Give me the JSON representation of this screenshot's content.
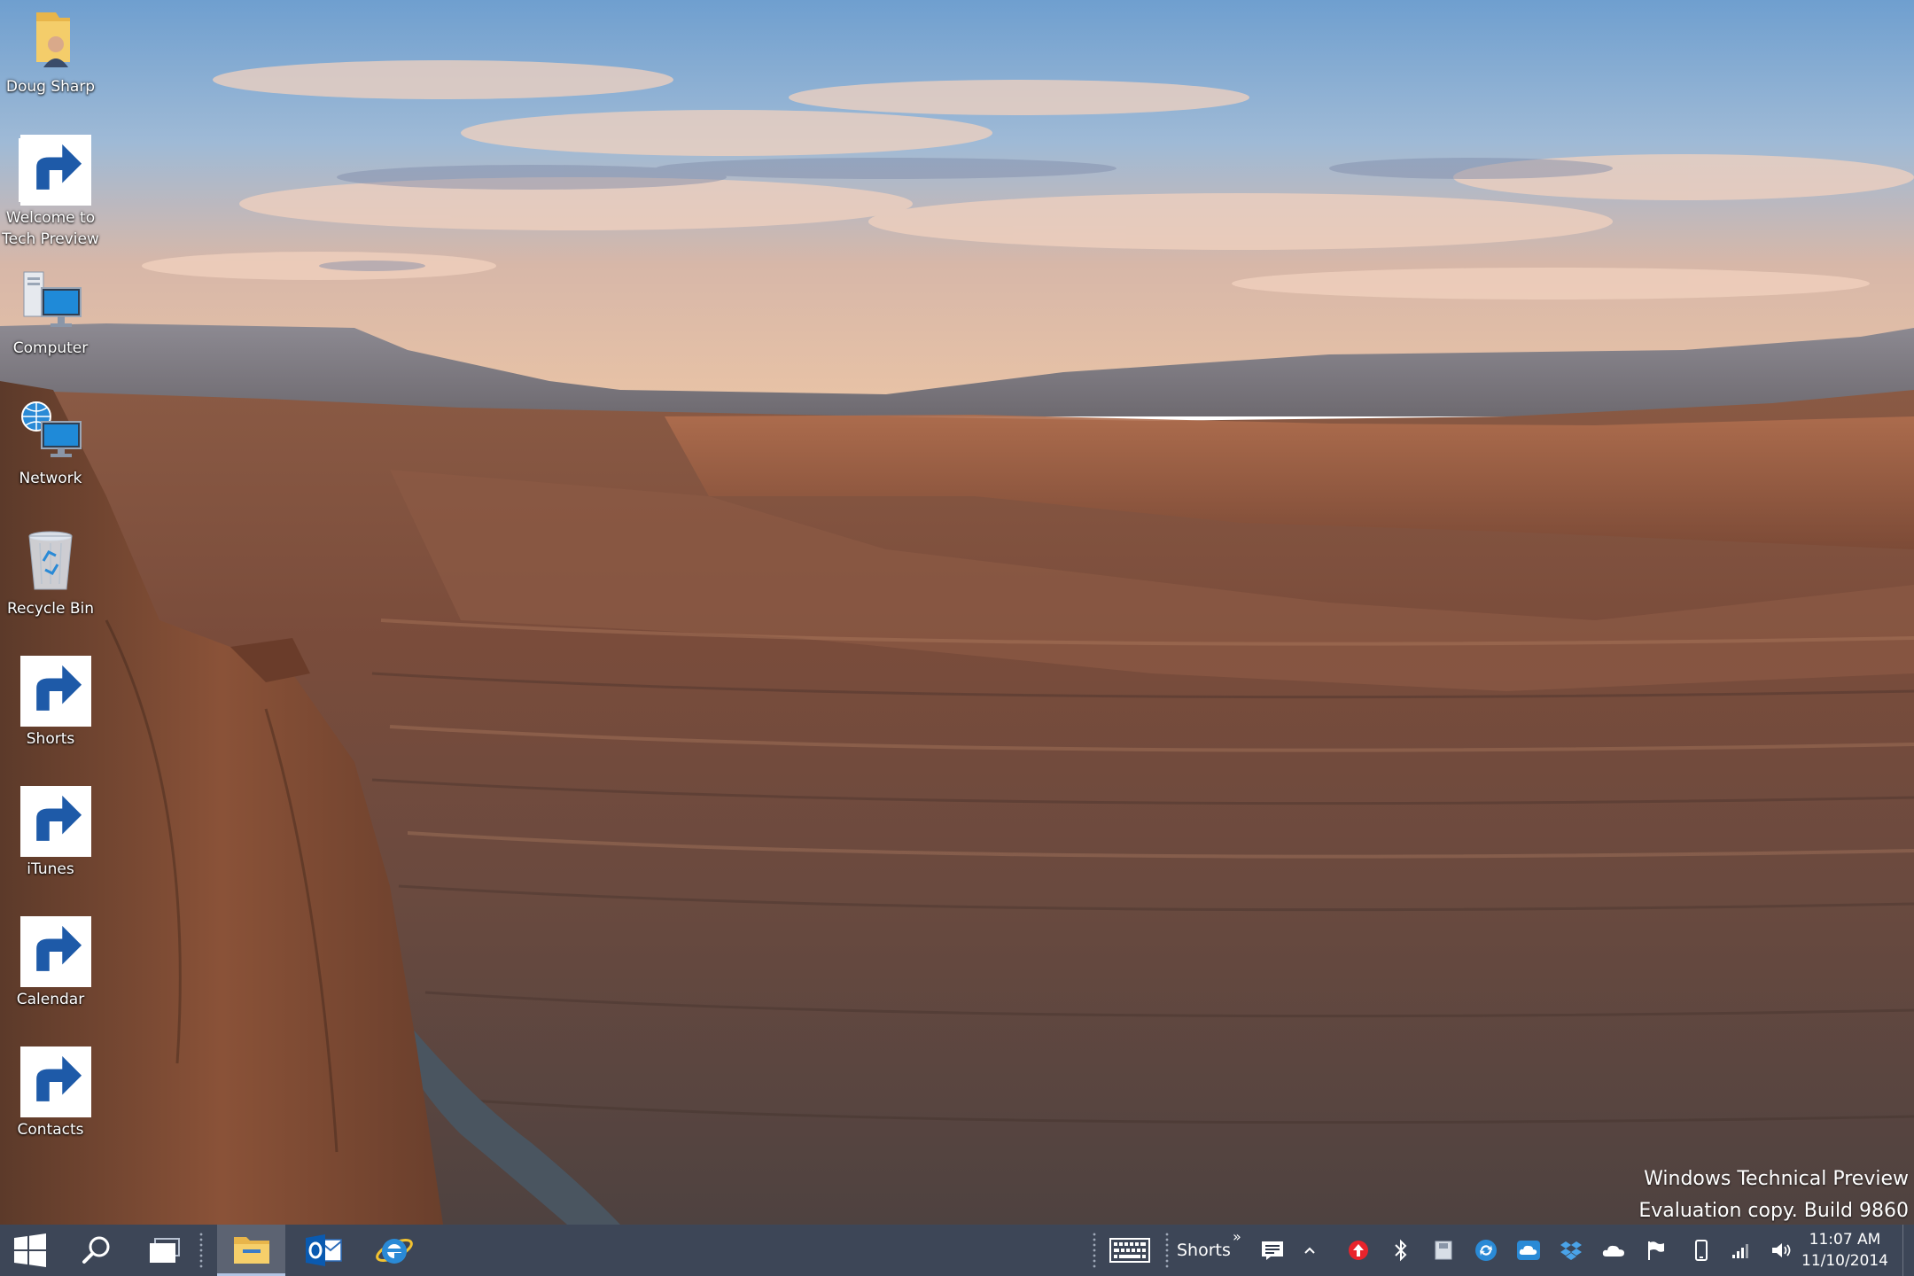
{
  "desktop": {
    "icons": [
      {
        "label": "Doug Sharp",
        "icon": "user-folder-icon",
        "shortcut": false
      },
      {
        "label": "Welcome to Tech Preview",
        "icon": "windows-logo-icon",
        "shortcut": true
      },
      {
        "label": "Computer",
        "icon": "computer-icon",
        "shortcut": false
      },
      {
        "label": "Network",
        "icon": "network-icon",
        "shortcut": false
      },
      {
        "label": "Recycle Bin",
        "icon": "recycle-bin-icon",
        "shortcut": false
      },
      {
        "label": "Shorts",
        "icon": "folder-icon",
        "shortcut": true
      },
      {
        "label": "iTunes",
        "icon": "itunes-icon",
        "shortcut": true
      },
      {
        "label": "Calendar",
        "icon": "calendar-icon",
        "shortcut": true
      },
      {
        "label": "Contacts",
        "icon": "contacts-icon",
        "shortcut": true
      }
    ],
    "watermark": {
      "line1": "Windows Technical Preview",
      "line2": "Evaluation copy. Build 9860"
    }
  },
  "taskbar": {
    "start": "windows-start-icon",
    "search": "search-icon",
    "task_view": "task-view-icon",
    "pinned": [
      {
        "name": "file-explorer",
        "icon": "file-explorer-icon",
        "active": true
      },
      {
        "name": "outlook",
        "icon": "outlook-icon",
        "active": false
      },
      {
        "name": "internet-explorer",
        "icon": "internet-explorer-icon",
        "active": false
      }
    ],
    "toolbar": {
      "keyboard_icon": "touch-keyboard-icon",
      "label": "Shorts",
      "chevron": "»"
    },
    "tray": {
      "icons": [
        "action-center-icon",
        "show-hidden-icons-chevron",
        "update-arrow-icon",
        "bluetooth-icon",
        "removable-drive-icon",
        "sync-icon",
        "cloud-icon",
        "dropbox-icon",
        "onedrive-icon",
        "flag-icon",
        "phone-icon",
        "signal-icon",
        "volume-icon"
      ]
    },
    "clock": {
      "time": "11:07 AM",
      "date": "11/10/2014"
    }
  },
  "colors": {
    "taskbar": "#2e384a",
    "windows_blue": "#1e90ff",
    "itunes_red": "#e8242c"
  }
}
